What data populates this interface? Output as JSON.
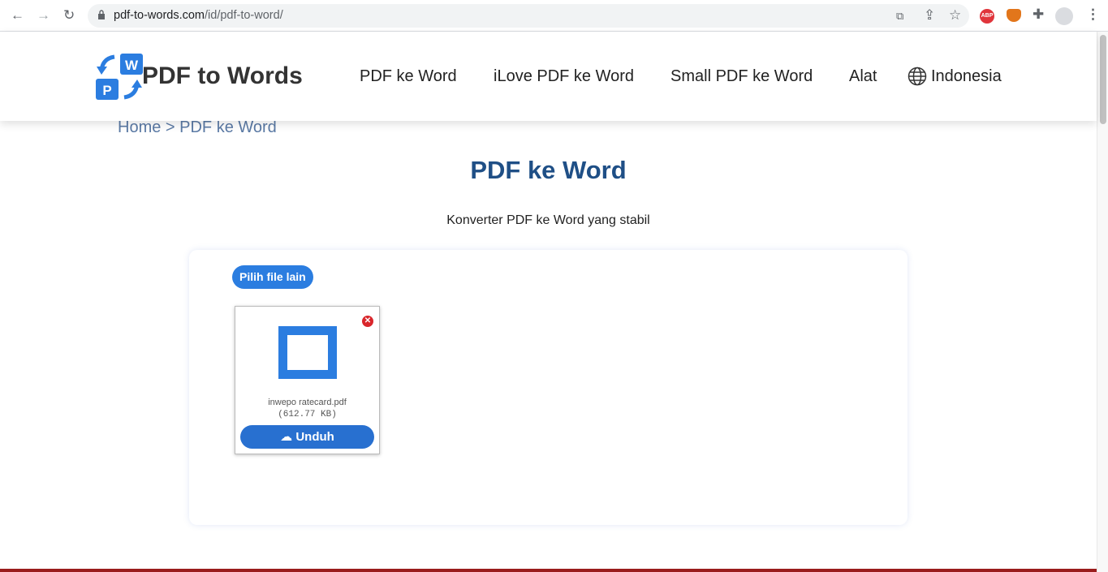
{
  "browser": {
    "url_domain": "pdf-to-words.com",
    "url_path": "/id/pdf-to-word/",
    "abp_label": "ABP"
  },
  "header": {
    "brand": "PDF to Words",
    "logo_letters": [
      "W",
      "P"
    ],
    "nav": [
      "PDF ke Word",
      "iLove PDF ke Word",
      "Small PDF ke Word",
      "Alat"
    ],
    "language": "Indonesia"
  },
  "breadcrumb": "Home > PDF ke Word",
  "title": "PDF ke Word",
  "subtitle": "Konverter PDF ke Word yang stabil",
  "converter": {
    "pick_label": "Pilih file lain",
    "file_name": "inwepo ratecard.pdf",
    "file_size": "(612.77 KB)",
    "download_label": "Unduh"
  },
  "colors": {
    "accent": "#2b7de0",
    "title": "#1f4f86"
  }
}
